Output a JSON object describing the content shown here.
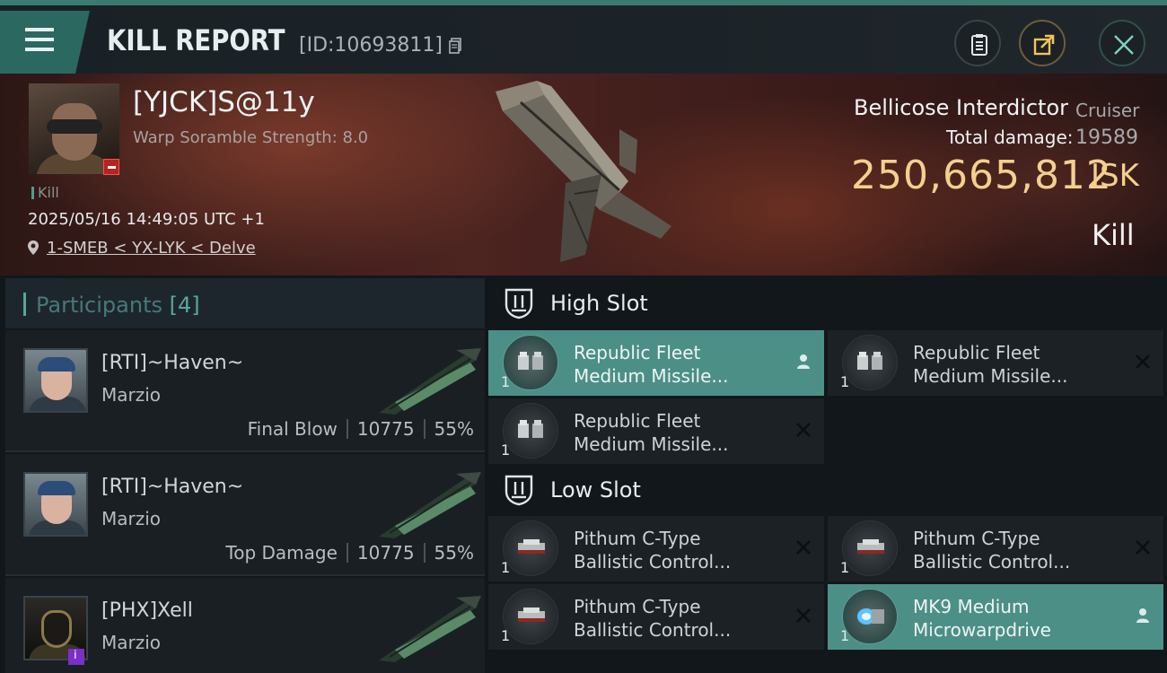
{
  "header": {
    "title": "KILL REPORT",
    "report_id": "[ID:10693811]",
    "icons": {
      "menu": "hamburger-menu-icon",
      "copy": "copy-icon",
      "doc": "document-icon",
      "share": "share-icon",
      "close": "close-icon"
    }
  },
  "victim": {
    "name": "[YJCK]S@11y",
    "attribute": "Warp Soramble Strength: 8.0",
    "tag": "Kill",
    "datetime": "2025/05/16 14:49:05 UTC +1",
    "location": "1-SMEB < YX-LYK < Delve"
  },
  "ship": {
    "name": "Bellicose Interdictor",
    "class": "Cruiser",
    "damage_label": "Total damage:",
    "damage_value": "19589",
    "isk_value": "250,665,812",
    "isk_unit": "ISK",
    "result": "Kill"
  },
  "participants": {
    "title": "Participants",
    "count": "[4]",
    "rows": [
      {
        "name": "[RTI]~Haven~",
        "corp": "Marzio",
        "role": "Final Blow",
        "damage": "10775",
        "percent": "55%"
      },
      {
        "name": "[RTI]~Haven~",
        "corp": "Marzio",
        "role": "Top Damage",
        "damage": "10775",
        "percent": "55%"
      },
      {
        "name": "[PHX]Xell",
        "corp": "Marzio",
        "role": "",
        "damage": "",
        "percent": ""
      }
    ]
  },
  "fitting": {
    "high_slot": {
      "title": "High Slot",
      "items": [
        {
          "name1": "Republic Fleet",
          "name2": "Medium Missile...",
          "qty": "1",
          "status": "person"
        },
        {
          "name1": "Republic Fleet",
          "name2": "Medium Missile...",
          "qty": "1",
          "status": "destroyed"
        },
        {
          "name1": "Republic Fleet",
          "name2": "Medium Missile...",
          "qty": "1",
          "status": "destroyed"
        }
      ]
    },
    "low_slot": {
      "title": "Low Slot",
      "items": [
        {
          "name1": "Pithum C-Type",
          "name2": "Ballistic Control...",
          "qty": "1",
          "status": "destroyed"
        },
        {
          "name1": "Pithum C-Type",
          "name2": "Ballistic Control...",
          "qty": "1",
          "status": "destroyed"
        },
        {
          "name1": "Pithum C-Type",
          "name2": "Ballistic Control...",
          "qty": "1",
          "status": "destroyed"
        },
        {
          "name1": "MK9 Medium",
          "name2": "Microwarpdrive",
          "qty": "1",
          "status": "person"
        }
      ]
    }
  },
  "colors": {
    "accent": "#4c8f86",
    "isk": "#f3d08d",
    "header_bar": "#2b6860"
  }
}
